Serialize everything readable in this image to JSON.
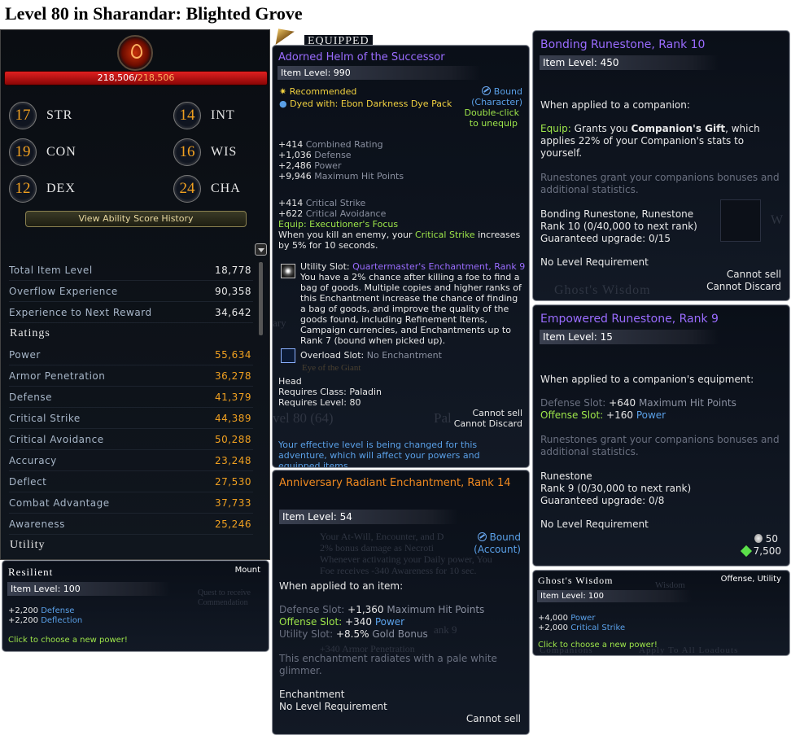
{
  "page_title": "Level 80 in Sharandar: Blighted Grove",
  "character": {
    "hp_current": "218,506",
    "hp_max": "218,506",
    "abilities": [
      {
        "value": "17",
        "label": "STR"
      },
      {
        "value": "14",
        "label": "INT"
      },
      {
        "value": "19",
        "label": "CON"
      },
      {
        "value": "16",
        "label": "WIS"
      },
      {
        "value": "12",
        "label": "DEX"
      },
      {
        "value": "24",
        "label": "CHA"
      }
    ],
    "history_button": "View Ability Score History",
    "summary": [
      {
        "label": "Total Item Level",
        "value": "18,778"
      },
      {
        "label": "Overflow Experience",
        "value": "90,358"
      },
      {
        "label": "Experience to Next Reward",
        "value": "34,642"
      }
    ],
    "ratings_heading": "Ratings",
    "ratings": [
      {
        "label": "Power",
        "value": "55,634"
      },
      {
        "label": "Armor Penetration",
        "value": "36,278"
      },
      {
        "label": "Defense",
        "value": "41,379"
      },
      {
        "label": "Critical Strike",
        "value": "44,389"
      },
      {
        "label": "Critical Avoidance",
        "value": "50,288"
      },
      {
        "label": "Accuracy",
        "value": "23,248"
      },
      {
        "label": "Deflect",
        "value": "27,530"
      },
      {
        "label": "Combat Advantage",
        "value": "37,733"
      },
      {
        "label": "Awareness",
        "value": "25,246"
      }
    ],
    "utility_heading": "Utility"
  },
  "resilient": {
    "title": "Resilient",
    "type": "Mount",
    "item_level": "Item Level: 100",
    "stats": [
      {
        "value": "+2,200",
        "label": "Defense"
      },
      {
        "value": "+2,200",
        "label": "Deflection"
      }
    ],
    "hint": "Click to choose a new power!",
    "bg_1": "Quest to receive",
    "bg_2": "Commendation"
  },
  "equipped": {
    "header": "Equipped",
    "name": "Adorned Helm of the Successor",
    "item_level": "Item Level: 990",
    "recommended": "Recommended",
    "dyed_prefix": "Dyed with:",
    "dye": "Ebon Darkness Dye Pack",
    "bound": "Bound",
    "bound_type": "(Character)",
    "unequip_1": "Double-click",
    "unequip_2": "to unequip",
    "base_stats": [
      {
        "value": "+414",
        "label": "Combined Rating"
      },
      {
        "value": "+1,036",
        "label": "Defense"
      },
      {
        "value": "+2,486",
        "label": "Power"
      },
      {
        "value": "+9,946",
        "label": "Maximum Hit Points"
      }
    ],
    "extra_stats": [
      {
        "value": "+414",
        "label": "Critical Strike"
      },
      {
        "value": "+622",
        "label": "Critical Avoidance"
      }
    ],
    "equip_label": "Equip: Executioner's Focus",
    "equip_desc_1": "When you kill an enemy, your",
    "equip_desc_hl": "Critical Strike",
    "equip_desc_2": "increases",
    "equip_desc_3": "by 5% for 10 seconds.",
    "utility_slot": "Utility Slot:",
    "utility_enchant": "Quartermaster's Enchantment, Rank 9",
    "utility_desc": "You have a 2% chance after killing a foe to find a bag of goods. Multiple copies and higher ranks of this Enchantment increase the chance of finding a bag of goods, and improve the quality of the goods found, including Refinement Items, Campaign currencies, and Enchantments up to Rank 7 (bound when picked up).",
    "overload_slot": "Overload Slot:",
    "overload_value": "No Enchantment",
    "slot": "Head",
    "req_class": "Requires Class: Paladin",
    "req_level": "Requires Level: 80",
    "cannot_sell": "Cannot sell",
    "cannot_discard": "Cannot Discard",
    "footer": "Your effective level is being changed for this adventure, which will affect your powers and equipped items.",
    "bg_1": "Eye of the Giant",
    "bg_2": "vel 80 (64)",
    "bg_3": "Pal",
    "bg_4": "ary"
  },
  "anniversary": {
    "name": "Anniversary Radiant Enchantment, Rank 14",
    "item_level": "Item Level: 54",
    "bound": "Bound",
    "bound_type": "(Account)",
    "applied": "When applied to an item:",
    "defense_slot": "Defense Slot:",
    "defense_val": "+1,360",
    "defense_stat": "Maximum Hit Points",
    "offense_slot": "Offense Slot:",
    "offense_val": "+340",
    "offense_stat": "Power",
    "utility_slot": "Utility Slot:",
    "utility_val": "+8.5%",
    "utility_stat": "Gold Bonus",
    "flavor": "This enchantment radiates with a pale white glimmer.",
    "type": "Enchantment",
    "req": "No Level Requirement",
    "cannot_sell": "Cannot sell",
    "bg_1": "Your At-Will, Encounter, and D",
    "bg_2": "2% bonus damage as Necroti",
    "bg_3": "Whenever activating your Daily power, You",
    "bg_4": "Foe receives -340 Awareness for 10 sec.",
    "bg_5": "+340 Armor Penetration",
    "bg_6": "ank 9"
  },
  "bonding": {
    "name": "Bonding Runestone, Rank 10",
    "item_level": "Item Level: 450",
    "applied": "When applied to a companion:",
    "equip_label": "Equip:",
    "equip_desc_1": "Grants you",
    "equip_desc_bold": "Companion's Gift",
    "equip_desc_2": ", which applies 22% of your Companion's stats to yourself.",
    "info": "Runestones grant your companions bonuses and additional statistics.",
    "type": "Bonding Runestone, Runestone",
    "rank_progress": "Rank 10 (0/40,000 to next rank)",
    "upgrade": "Guaranteed upgrade: 0/15",
    "req": "No Level Requirement",
    "cannot_sell": "Cannot sell",
    "cannot_discard": "Cannot Discard",
    "bg_1": "Ghost's Wisdom",
    "bg_2": "W"
  },
  "empowered": {
    "name": "Empowered Runestone, Rank 9",
    "item_level": "Item Level: 15",
    "applied": "When applied to a companion's equipment:",
    "defense_slot": "Defense Slot:",
    "defense_val": "+640",
    "defense_stat": "Maximum Hit Points",
    "offense_slot": "Offense Slot:",
    "offense_val": "+160",
    "offense_stat": "Power",
    "info": "Runestones grant your companions bonuses and additional statistics.",
    "type": "Runestone",
    "rank_progress": "Rank 9 (0/30,000 to next rank)",
    "upgrade": "Guaranteed upgrade: 0/8",
    "req": "No Level Requirement",
    "price_silver": "50",
    "price_gold": "7,500"
  },
  "ghost": {
    "title": "Ghost's Wisdom",
    "type": "Offense, Utility",
    "item_level": "Item Level: 100",
    "stats": [
      {
        "value": "+4,000",
        "label": "Power"
      },
      {
        "value": "+2,000",
        "label": "Critical Strike"
      }
    ],
    "hint": "Click to choose a new power!",
    "bg_1": "Apply To All Loadouts",
    "bg_2": "Companions",
    "bg_3": "Wisdom"
  },
  "colors": {
    "purple": "#9a6cff",
    "orange": "#f08a20",
    "green": "#9ee64a",
    "blue": "#5aa0e8",
    "gold": "#f0a020",
    "hp_red": "#e02020"
  }
}
